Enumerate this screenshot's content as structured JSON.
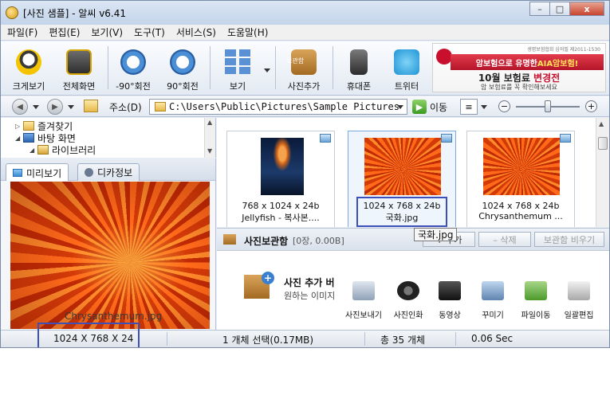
{
  "window": {
    "title": "[사진 샘플] - 알씨 v6.41",
    "minimize_label": "–",
    "maximize_label": "□",
    "close_label": "x"
  },
  "menu": [
    "파일(F)",
    "편집(E)",
    "보기(V)",
    "도구(T)",
    "서비스(S)",
    "도움말(H)"
  ],
  "toolbar": {
    "magnify": "크게보기",
    "fullscreen": "전체화면",
    "rotate_left": "-90°회전",
    "rotate_right": "90°회전",
    "view": "보기",
    "add_photo": "사진추가",
    "add_photo_badge": "보관함",
    "phone": "휴대폰",
    "twitter": "트위터"
  },
  "ad": {
    "fine_print": "생명보험협회 심의필 제2011-1530",
    "ribbon_pre": "암보험으로 유명한 ",
    "ribbon_highlight": "AIA암보험!",
    "headline_pre": "10월 보험료 ",
    "headline_highlight": "변경전",
    "sub": "암 보험료를 꼭 확인해보세요"
  },
  "address": {
    "label": "주소(D)",
    "path": "C:\\Users\\Public\\Pictures\\Sample Pictures",
    "go_label": "이동"
  },
  "tree": {
    "items": [
      "즐겨찾기",
      "바탕 화면",
      "라이브러리"
    ]
  },
  "preview_tabs": {
    "preview": "미리보기",
    "exif": "디카정보"
  },
  "preview": {
    "caption": "Chrysanthemum.jpg"
  },
  "thumbnails": [
    {
      "dims": "768 x 1024 x 24b",
      "name": "Jellyfish - 복사본...."
    },
    {
      "dims": "1024 x 768 x 24b",
      "name": "국화.jpg"
    },
    {
      "dims": "1024 x 768 x 24b",
      "name": "Chrysanthemum ..."
    }
  ],
  "tooltip": "국화.jpg",
  "storage": {
    "title": "사진보관함",
    "count": "[0장, 0.00B]",
    "add_button": "+ 추가",
    "delete_button": "– 삭제",
    "clear_button": "보관함 비우기",
    "promo_title": "사진 추가 버",
    "promo_sub": "원하는 이미지",
    "actions": [
      "사진보내기",
      "사진인화",
      "동영상",
      "꾸미기",
      "파일이동",
      "일괄편집"
    ]
  },
  "status": {
    "dimensions": "1024 X 768 X 24",
    "selection": "1 개체 선택(0.17MB)",
    "total": "총 35 개체",
    "time": "0.06 Sec"
  }
}
